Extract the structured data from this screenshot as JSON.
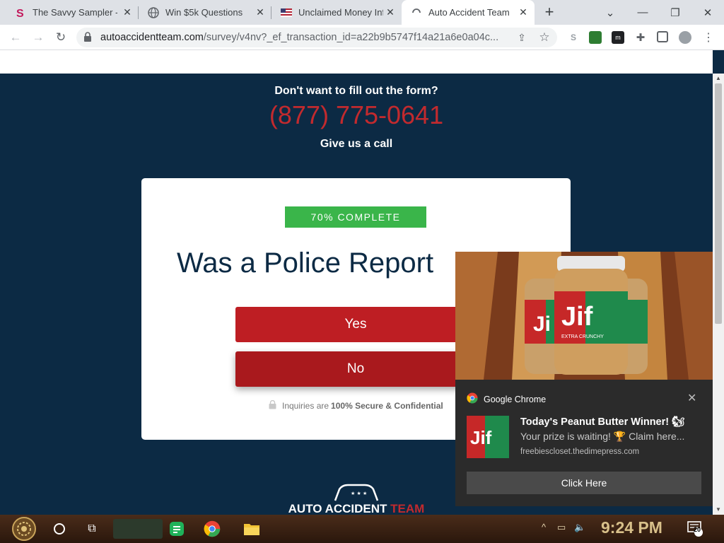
{
  "browser": {
    "tabs": [
      {
        "title": "The Savvy Sampler -",
        "icon": "savvy-s-icon",
        "active": false
      },
      {
        "title": "Win $5k Questions",
        "icon": "globe-icon",
        "active": false
      },
      {
        "title": "Unclaimed Money Inf",
        "icon": "us-flag-icon",
        "active": false
      },
      {
        "title": "Auto Accident Team",
        "icon": "loading-spinner-icon",
        "active": true
      }
    ],
    "new_tab_icon": "plus-icon",
    "url_host": "autoaccidentteam.com",
    "url_path": "/survey/v4nv?_ef_transaction_id=a22b9b5747f14a21a6e0a04c..."
  },
  "page": {
    "call_prompt": "Don't want to fill out the form?",
    "phone": "(877) 775-0641",
    "call_cta": "Give us a call",
    "progress_label": "70% COMPLETE",
    "progress_value": 0.7,
    "question": "Was a Police Report",
    "answers": {
      "yes": "Yes",
      "no": "No"
    },
    "secure_pre": "Inquiries are",
    "secure_bold": "100% Secure & Confidential",
    "logo_word_white": "AUTO ACCIDENT",
    "logo_word_red": "TEAM"
  },
  "notification": {
    "source": "Google Chrome",
    "title": "Today's Peanut Butter Winner! 🐿",
    "body": "Your prize is waiting! 🏆 Claim here...",
    "site": "freebiescloset.thedimepress.com",
    "button": "Click Here",
    "brand_logo": "Jif"
  },
  "taskbar": {
    "time": "9:24 PM",
    "notification_count": "20"
  },
  "colors": {
    "page_bg": "#0c2a44",
    "accent_red": "#be1e23",
    "progress_green": "#3ab54a"
  }
}
